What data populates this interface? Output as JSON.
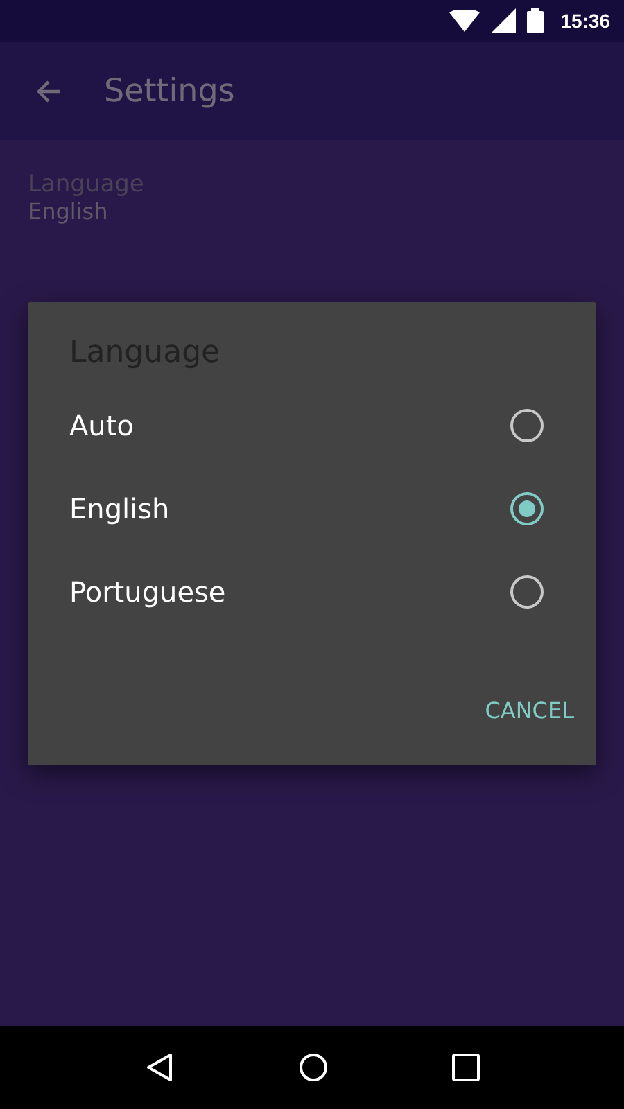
{
  "status_bar": {
    "time": "15:36"
  },
  "app_bar": {
    "title": "Settings"
  },
  "settings": [
    {
      "title": "Language",
      "value": "English"
    }
  ],
  "dialog": {
    "title": "Language",
    "options": [
      {
        "label": "Auto",
        "selected": false
      },
      {
        "label": "English",
        "selected": true
      },
      {
        "label": "Portuguese",
        "selected": false
      }
    ],
    "buttons": [
      "CANCEL"
    ]
  }
}
